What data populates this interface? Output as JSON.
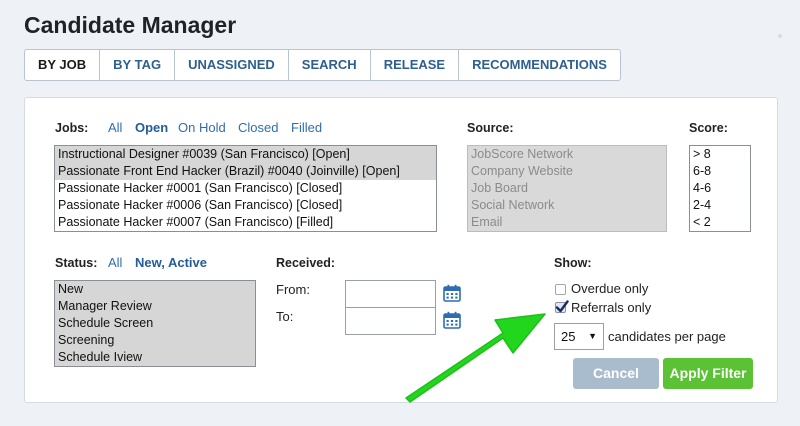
{
  "header": {
    "title": "Candidate Manager"
  },
  "tabs": [
    {
      "label": "BY JOB",
      "active": true
    },
    {
      "label": "BY TAG"
    },
    {
      "label": "UNASSIGNED"
    },
    {
      "label": "SEARCH"
    },
    {
      "label": "RELEASE"
    },
    {
      "label": "RECOMMENDATIONS"
    }
  ],
  "jobs": {
    "label": "Jobs:",
    "filters": [
      "All",
      "Open",
      "On Hold",
      "Closed",
      "Filled"
    ],
    "active_filter": "Open",
    "items": [
      {
        "text": "Instructional Designer #0039 (San Francisco) [Open]",
        "selected": true
      },
      {
        "text": "Passionate Front End Hacker (Brazil) #0040 (Joinville) [Open]",
        "selected": true
      },
      {
        "text": "Passionate Hacker #0001 (San Francisco) [Closed]",
        "selected": false
      },
      {
        "text": "Passionate Hacker #0006 (San Francisco) [Closed]",
        "selected": false
      },
      {
        "text": "Passionate Hacker #0007 (San Francisco) [Filled]",
        "selected": false
      }
    ]
  },
  "source": {
    "label": "Source:",
    "items": [
      "JobScore Network",
      "Company Website",
      "Job Board",
      "Social Network",
      "Email"
    ]
  },
  "score": {
    "label": "Score:",
    "items": [
      "> 8",
      "6-8",
      "4-6",
      "2-4",
      "< 2"
    ]
  },
  "status": {
    "label": "Status:",
    "filters": [
      "All",
      "New, Active"
    ],
    "active_filter": "New, Active",
    "items": [
      "New",
      "Manager Review",
      "Schedule Screen",
      "Screening",
      "Schedule Iview"
    ]
  },
  "received": {
    "label": "Received:",
    "from_label": "From:",
    "to_label": "To:",
    "from_value": "",
    "to_value": ""
  },
  "show": {
    "label": "Show:",
    "overdue_label": "Overdue only",
    "overdue_checked": false,
    "referrals_label": "Referrals only",
    "referrals_checked": true,
    "per_page_value": "25",
    "per_page_label": "candidates per page"
  },
  "buttons": {
    "cancel": "Cancel",
    "apply": "Apply Filter"
  },
  "colors": {
    "accent_link": "#2e6fb0",
    "apply_green": "#5bc236",
    "cancel_blue": "#a9bccd",
    "arrow_green": "#22d61d"
  }
}
